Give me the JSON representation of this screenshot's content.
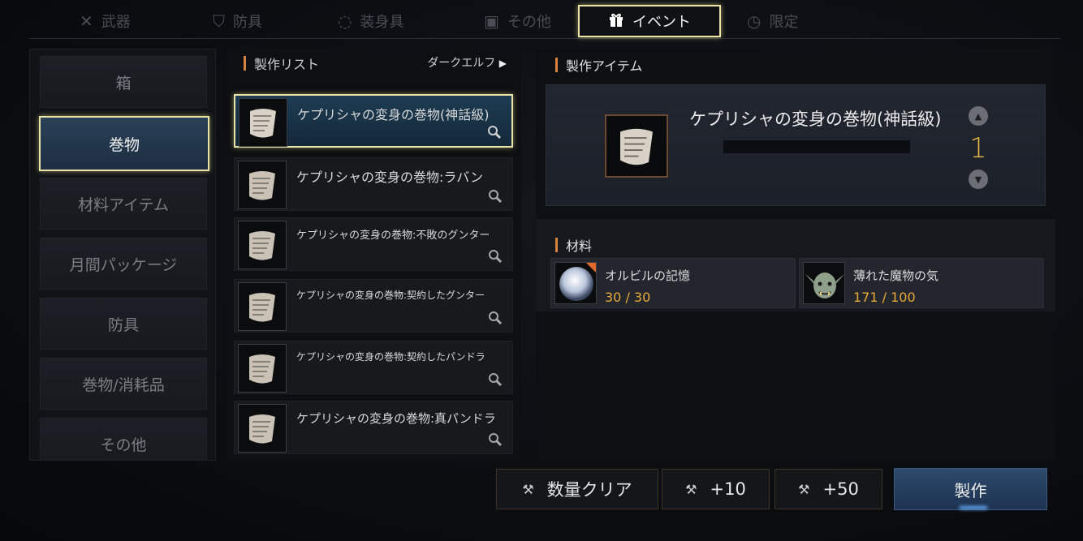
{
  "tabs": [
    {
      "label": "武器",
      "icon": "crossed-swords-icon"
    },
    {
      "label": "防具",
      "icon": "shield-icon"
    },
    {
      "label": "装身具",
      "icon": "necklace-icon"
    },
    {
      "label": "その他",
      "icon": "box-icon"
    },
    {
      "label": "イベント",
      "icon": "gift-icon",
      "active": true
    },
    {
      "label": "限定",
      "icon": "timer-icon"
    }
  ],
  "categories": [
    "箱",
    "巻物",
    "材料アイテム",
    "月間パッケージ",
    "防具",
    "巻物/消耗品",
    "その他"
  ],
  "active_category": "巻物",
  "list": {
    "title": "製作リスト",
    "race_filter": "ダークエルフ",
    "items": [
      "ケプリシャの変身の巻物(神話級)",
      "ケプリシャの変身の巻物:ラバン",
      "ケプリシャの変身の巻物:不敗のグンター",
      "ケプリシャの変身の巻物:契約したグンター",
      "ケプリシャの変身の巻物:契約したパンドラ",
      "ケプリシャの変身の巻物:真パンドラ"
    ]
  },
  "craft": {
    "title": "製作アイテム",
    "item_name": "ケプリシャの変身の巻物(神話級)",
    "quantity": "1"
  },
  "materials": {
    "title": "材料",
    "items": [
      {
        "name": "オルビルの記憶",
        "count": "30 / 30"
      },
      {
        "name": "薄れた魔物の気",
        "count": "171 / 100"
      }
    ]
  },
  "buttons": {
    "clear": "数量クリア",
    "plus10": "+10",
    "plus50": "+50",
    "craft": "製作"
  },
  "colors": {
    "accent_gold": "#e9e3a8",
    "count_orange": "#e7a93a",
    "section_bar": "#d7823f",
    "craft_button": "#2c4a6c"
  }
}
